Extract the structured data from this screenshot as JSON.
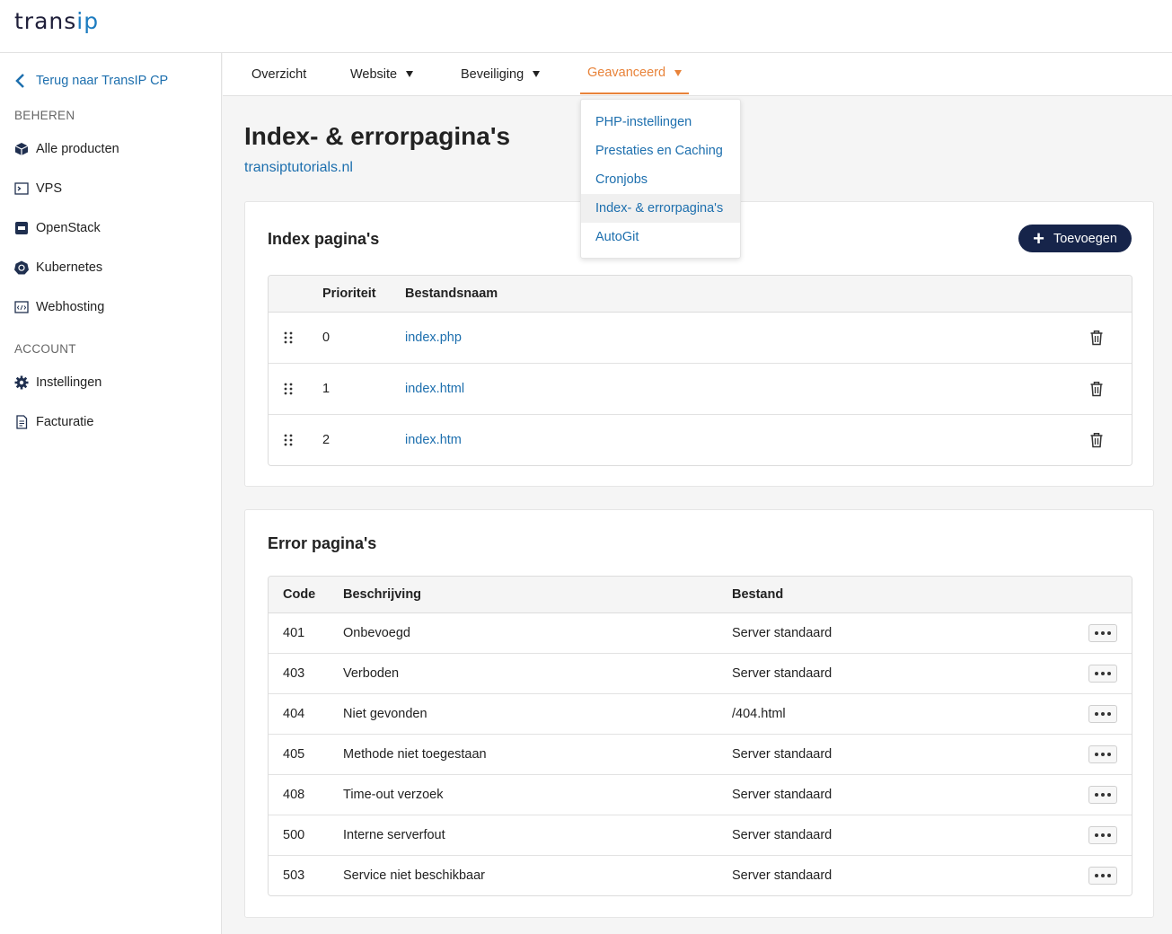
{
  "header": {
    "logo_part1": "trans",
    "logo_part2": "ip"
  },
  "sidebar": {
    "back_label": "Terug naar TransIP CP",
    "heading_manage": "BEHEREN",
    "manage_items": [
      {
        "label": "Alle producten",
        "icon": "cube-icon"
      },
      {
        "label": "VPS",
        "icon": "terminal-icon"
      },
      {
        "label": "OpenStack",
        "icon": "openstack-icon"
      },
      {
        "label": "Kubernetes",
        "icon": "kubernetes-icon"
      },
      {
        "label": "Webhosting",
        "icon": "code-window-icon"
      }
    ],
    "heading_account": "ACCOUNT",
    "account_items": [
      {
        "label": "Instellingen",
        "icon": "gear-icon"
      },
      {
        "label": "Facturatie",
        "icon": "invoice-icon"
      }
    ]
  },
  "tabs": [
    {
      "label": "Overzicht"
    },
    {
      "label": "Website"
    },
    {
      "label": "Beveiliging"
    },
    {
      "label": "Geavanceerd"
    }
  ],
  "dropdown": [
    "PHP-instellingen",
    "Prestaties en Caching",
    "Cronjobs",
    "Index- & errorpagina's",
    "AutoGit"
  ],
  "page": {
    "title": "Index- & errorpagina's",
    "domain": "transiptutorials.nl"
  },
  "index_card": {
    "title": "Index pagina's",
    "add_label": "Toevoegen",
    "headers": {
      "priority": "Prioriteit",
      "filename": "Bestandsnaam"
    },
    "rows": [
      {
        "priority": "0",
        "filename": "index.php"
      },
      {
        "priority": "1",
        "filename": "index.html"
      },
      {
        "priority": "2",
        "filename": "index.htm"
      }
    ]
  },
  "error_card": {
    "title": "Error pagina's",
    "headers": {
      "code": "Code",
      "description": "Beschrijving",
      "file": "Bestand"
    },
    "rows": [
      {
        "code": "401",
        "description": "Onbevoegd",
        "file": "Server standaard"
      },
      {
        "code": "403",
        "description": "Verboden",
        "file": "Server standaard"
      },
      {
        "code": "404",
        "description": "Niet gevonden",
        "file": "/404.html"
      },
      {
        "code": "405",
        "description": "Methode niet toegestaan",
        "file": "Server standaard"
      },
      {
        "code": "408",
        "description": "Time-out verzoek",
        "file": "Server standaard"
      },
      {
        "code": "500",
        "description": "Interne serverfout",
        "file": "Server standaard"
      },
      {
        "code": "503",
        "description": "Service niet beschikbaar",
        "file": "Server standaard"
      }
    ]
  },
  "colors": {
    "accent": "#e8833a",
    "link": "#1d6fae",
    "button": "#16244a"
  }
}
